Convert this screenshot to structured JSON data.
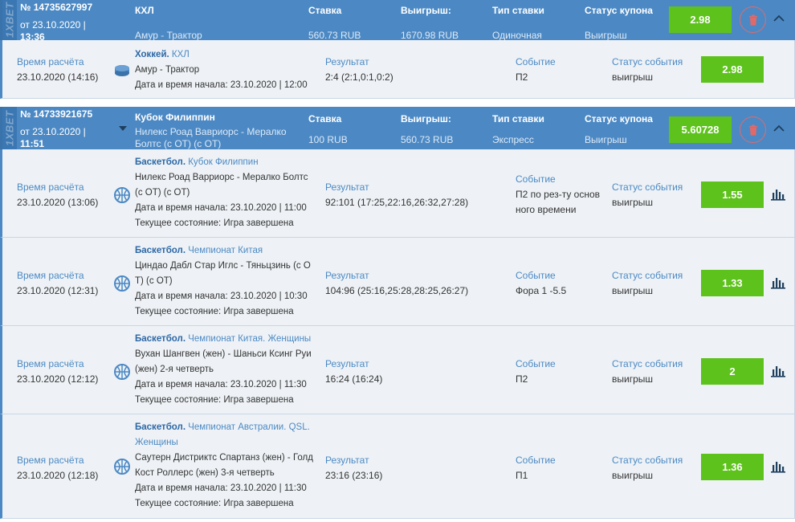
{
  "brand": "1XBET",
  "coupons": [
    {
      "number": "№ 14735627997",
      "date": "от 23.10.2020 |",
      "time": "13:36",
      "championship": "КХЛ",
      "match": "Амур - Трактор",
      "stake_label": "Ставка",
      "stake": "560.73 RUB",
      "win_label": "Выигрыш:",
      "win": "1670.98 RUB",
      "type_label": "Тип ставки",
      "type": "Одиночная",
      "status_label": "Статус купона",
      "status": "Выигрыш",
      "coef": "2.98",
      "events": [
        {
          "calc_label": "Время расчёта",
          "calc_time": "23.10.2020 (14:16)",
          "sport": "Хоккей.",
          "league": " КХЛ",
          "teams_1": "Амур - Трактор",
          "teams_2": "",
          "start": "Дата и время начала: 23.10.2020 | 12:00",
          "state": "",
          "result_label": "Результат",
          "result": "2:4 (2:1,0:1,0:2)",
          "event_label": "Событие",
          "event_1": "П2",
          "event_2": "",
          "status_label": "Статус события",
          "status": "выигрыш",
          "coef": "2.98"
        }
      ]
    },
    {
      "number": "№ 14733921675",
      "date": "от 23.10.2020 |",
      "time": "11:51",
      "championship": "Кубок Филиппин",
      "match": "Нилекс Роад Вавриорс - Мералко Болтс (с ОТ) (с ОТ)",
      "stake_label": "Ставка",
      "stake": "100 RUB",
      "win_label": "Выигрыш:",
      "win": "560.73 RUB",
      "type_label": "Тип ставки",
      "type": "Экспресс",
      "status_label": "Статус купона",
      "status": "Выигрыш",
      "coef": "5.60728",
      "events": [
        {
          "calc_label": "Время расчёта",
          "calc_time": "23.10.2020 (13:06)",
          "sport": "Баскетбол.",
          "league": " Кубок Филиппин",
          "teams_1": "Нилекс Роад Варриорс - Мералко Болтс",
          "teams_2": "(с ОТ) (с ОТ)",
          "start": "Дата и время начала: 23.10.2020 | 11:00",
          "state": "Текущее состояние: Игра завершена",
          "result_label": "Результат",
          "result": "92:101 (17:25,22:16,26:32,27:28)",
          "event_label": "Событие",
          "event_1": "П2 по рез-ту основ",
          "event_2": "ного времени",
          "status_label": "Статус события",
          "status": "выигрыш",
          "coef": "1.55"
        },
        {
          "calc_label": "Время расчёта",
          "calc_time": "23.10.2020 (12:31)",
          "sport": "Баскетбол.",
          "league": " Чемпионат Китая",
          "teams_1": "Циндао Дабл Стар Иглс - Тяньцзинь (с О",
          "teams_2": "Т) (с ОТ)",
          "start": "Дата и время начала: 23.10.2020 | 10:30",
          "state": "Текущее состояние: Игра завершена",
          "result_label": "Результат",
          "result": "104:96 (25:16,25:28,28:25,26:27)",
          "event_label": "Событие",
          "event_1": "Фора 1 -5.5",
          "event_2": "",
          "status_label": "Статус события",
          "status": "выигрыш",
          "coef": "1.33"
        },
        {
          "calc_label": "Время расчёта",
          "calc_time": "23.10.2020 (12:12)",
          "sport": "Баскетбол.",
          "league": " Чемпионат Китая. Женщины",
          "teams_1": "Вухан Шангвен (жен) - Шаньси Ксинг Руи",
          "teams_2": "(жен) 2-я четверть",
          "start": "Дата и время начала: 23.10.2020 | 11:30",
          "state": "Текущее состояние: Игра завершена",
          "result_label": "Результат",
          "result": "16:24 (16:24)",
          "event_label": "Событие",
          "event_1": "П2",
          "event_2": "",
          "status_label": "Статус события",
          "status": "выигрыш",
          "coef": "2"
        },
        {
          "calc_label": "Время расчёта",
          "calc_time": "23.10.2020 (12:18)",
          "sport": "Баскетбол.",
          "league": " Чемпионат Австралии. QSL.",
          "league_2": "Женщины",
          "teams_1": "Саутерн Дистриктс Спартанз (жен) - Голд",
          "teams_2": "Кост Роллерс (жен) 3-я четверть",
          "start": "Дата и время начала: 23.10.2020 | 11:30",
          "state": "Текущее состояние: Игра завершена",
          "result_label": "Результат",
          "result": "23:16 (23:16)",
          "event_label": "Событие",
          "event_1": "П1",
          "event_2": "",
          "status_label": "Статус события",
          "status": "выигрыш",
          "coef": "1.36"
        }
      ]
    }
  ],
  "colors": {
    "header_bg": "#4c89c4",
    "row_bg": "#eef2f6",
    "coef_green": "#5ec21c",
    "delete_red": "#e06a6a",
    "label_blue": "#4c89c4"
  }
}
